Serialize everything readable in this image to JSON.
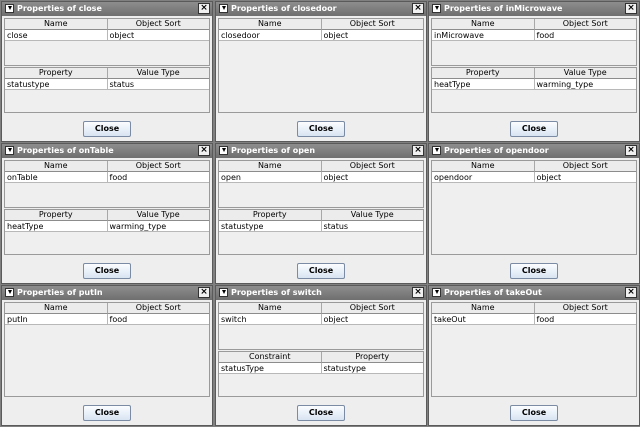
{
  "close_glyph": "×",
  "button_label": "Close",
  "windows": [
    {
      "title": "Properties of close",
      "obj_headers": [
        "Name",
        "Object Sort"
      ],
      "obj_rows": [
        [
          "close",
          "object"
        ]
      ],
      "prop_headers": [
        "Property",
        "Value Type"
      ],
      "prop_rows": [
        [
          "statustype",
          "status"
        ]
      ]
    },
    {
      "title": "Properties of closedoor",
      "obj_headers": [
        "Name",
        "Object Sort"
      ],
      "obj_rows": [
        [
          "closedoor",
          "object"
        ]
      ]
    },
    {
      "title": "Properties of inMicrowave",
      "obj_headers": [
        "Name",
        "Object Sort"
      ],
      "obj_rows": [
        [
          "inMicrowave",
          "food"
        ]
      ],
      "prop_headers": [
        "Property",
        "Value Type"
      ],
      "prop_rows": [
        [
          "heatType",
          "warming_type"
        ]
      ]
    },
    {
      "title": "Properties of onTable",
      "obj_headers": [
        "Name",
        "Object Sort"
      ],
      "obj_rows": [
        [
          "onTable",
          "food"
        ]
      ],
      "prop_headers": [
        "Property",
        "Value Type"
      ],
      "prop_rows": [
        [
          "heatType",
          "warming_type"
        ]
      ]
    },
    {
      "title": "Properties of open",
      "obj_headers": [
        "Name",
        "Object Sort"
      ],
      "obj_rows": [
        [
          "open",
          "object"
        ]
      ],
      "prop_headers": [
        "Property",
        "Value Type"
      ],
      "prop_rows": [
        [
          "statustype",
          "status"
        ]
      ]
    },
    {
      "title": "Properties of opendoor",
      "obj_headers": [
        "Name",
        "Object Sort"
      ],
      "obj_rows": [
        [
          "opendoor",
          "object"
        ]
      ]
    },
    {
      "title": "Properties of putIn",
      "obj_headers": [
        "Name",
        "Object Sort"
      ],
      "obj_rows": [
        [
          "putIn",
          "food"
        ]
      ]
    },
    {
      "title": "Properties of switch",
      "obj_headers": [
        "Name",
        "Object Sort"
      ],
      "obj_rows": [
        [
          "switch",
          "object"
        ]
      ],
      "prop_headers": [
        "Constraint",
        "Property"
      ],
      "prop_rows": [
        [
          "statusType",
          "statustype"
        ]
      ]
    },
    {
      "title": "Properties of takeOut",
      "obj_headers": [
        "Name",
        "Object Sort"
      ],
      "obj_rows": [
        [
          "takeOut",
          "food"
        ]
      ]
    }
  ]
}
